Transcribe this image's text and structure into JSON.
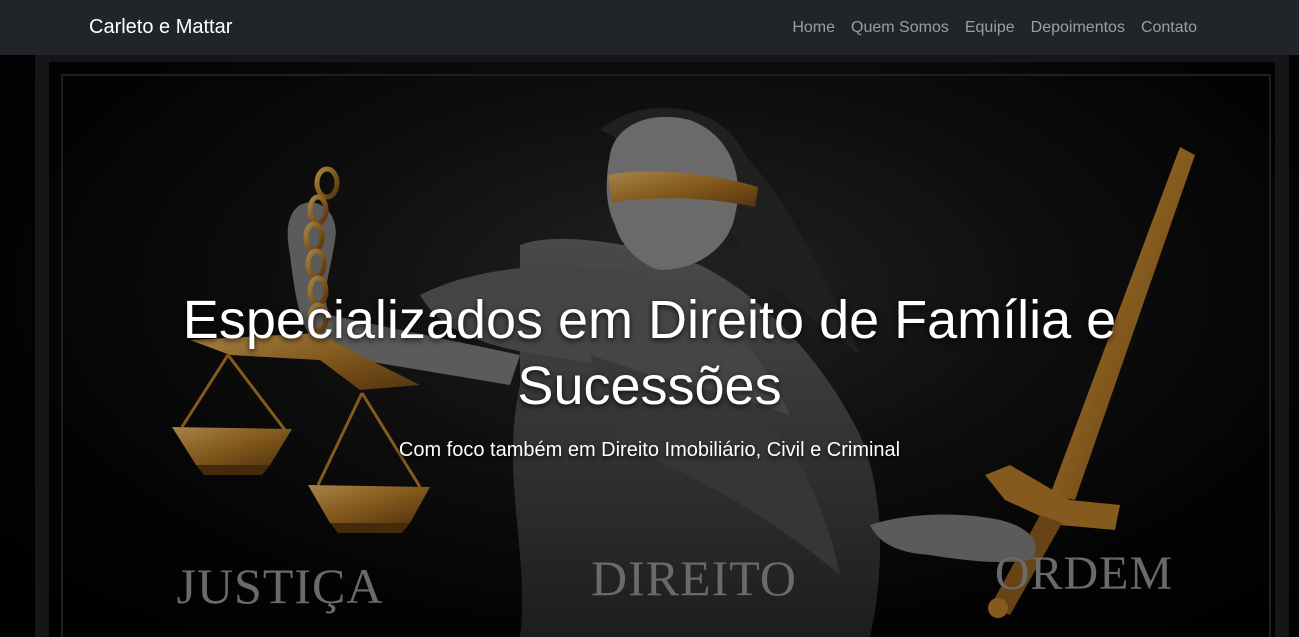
{
  "navbar": {
    "brand": "Carleto e Mattar",
    "links": [
      {
        "label": "Home"
      },
      {
        "label": "Quem Somos"
      },
      {
        "label": "Equipe"
      },
      {
        "label": "Depoimentos"
      },
      {
        "label": "Contato"
      }
    ]
  },
  "hero": {
    "title": "Especializados em Direito de Família e Sucessões",
    "subtitle": "Com foco também em Direito Imobiliário, Civil e Criminal",
    "engraved_words": [
      "JUSTIÇA",
      "DIREITO",
      "ORDEM"
    ]
  },
  "colors": {
    "navbar_bg": "#212529",
    "nav_link": "rgba(255,255,255,0.55)",
    "brand": "#ffffff",
    "gold": "#c08a3a"
  },
  "icons": [
    "scales-of-justice-icon",
    "sword-icon",
    "lady-justice-figure"
  ]
}
